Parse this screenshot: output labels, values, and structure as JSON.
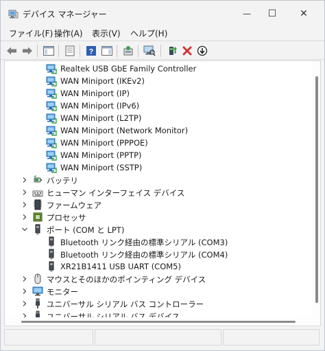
{
  "window": {
    "title": "デバイス マネージャー",
    "minimize_glyph": "—",
    "maximize_glyph": "☐",
    "close_glyph": "✕"
  },
  "menu": {
    "items": [
      "ファイル(F)",
      "操作(A)",
      "表示(V)",
      "ヘルプ(H)"
    ]
  },
  "toolbar": {
    "icons": [
      "back-arrow-icon",
      "forward-arrow-icon",
      "show-hide-console-tree-icon",
      "properties-icon",
      "help-icon",
      "action-pane-icon",
      "update-driver-icon",
      "scan-hardware-icon",
      "enable-device-icon",
      "uninstall-device-icon",
      "disable-device-icon"
    ]
  },
  "tree": {
    "rows": [
      {
        "label": "Realtek USB GbE Family Controller",
        "icon": "network-adapter-icon",
        "indent": 2
      },
      {
        "label": "WAN Miniport (IKEv2)",
        "icon": "network-adapter-icon",
        "indent": 2
      },
      {
        "label": "WAN Miniport (IP)",
        "icon": "network-adapter-icon",
        "indent": 2
      },
      {
        "label": "WAN Miniport (IPv6)",
        "icon": "network-adapter-icon",
        "indent": 2
      },
      {
        "label": "WAN Miniport (L2TP)",
        "icon": "network-adapter-icon",
        "indent": 2
      },
      {
        "label": "WAN Miniport (Network Monitor)",
        "icon": "network-adapter-icon",
        "indent": 2
      },
      {
        "label": "WAN Miniport (PPPOE)",
        "icon": "network-adapter-icon",
        "indent": 2
      },
      {
        "label": "WAN Miniport (PPTP)",
        "icon": "network-adapter-icon",
        "indent": 2
      },
      {
        "label": "WAN Miniport (SSTP)",
        "icon": "network-adapter-icon",
        "indent": 2
      },
      {
        "label": "バッテリ",
        "icon": "battery-icon",
        "indent": 1,
        "expander": "collapsed"
      },
      {
        "label": "ヒューマン インターフェイス デバイス",
        "icon": "hid-icon",
        "indent": 1,
        "expander": "collapsed"
      },
      {
        "label": "ファームウェア",
        "icon": "firmware-icon",
        "indent": 1,
        "expander": "collapsed"
      },
      {
        "label": "プロセッサ",
        "icon": "processor-icon",
        "indent": 1,
        "expander": "collapsed"
      },
      {
        "label": "ポート (COM と LPT)",
        "icon": "port-icon",
        "indent": 1,
        "expander": "expanded"
      },
      {
        "label": "Bluetooth リンク経由の標準シリアル (COM3)",
        "icon": "port-icon",
        "indent": 2
      },
      {
        "label": "Bluetooth リンク経由の標準シリアル (COM4)",
        "icon": "port-icon",
        "indent": 2
      },
      {
        "label": "XR21B1411 USB UART (COM5)",
        "icon": "port-icon",
        "indent": 2
      },
      {
        "label": "マウスとそのほかのポインティング デバイス",
        "icon": "mouse-icon",
        "indent": 1,
        "expander": "collapsed"
      },
      {
        "label": "モニター",
        "icon": "monitor-icon",
        "indent": 1,
        "expander": "collapsed"
      },
      {
        "label": "ユニバーサル シリアル バス コントローラー",
        "icon": "usb-icon",
        "indent": 1,
        "expander": "collapsed"
      },
      {
        "label": "ユニバーサル シリアル バス デバイス",
        "icon": "usb-icon",
        "indent": 1,
        "expander": "collapsed"
      }
    ]
  },
  "colors": {
    "accent": "#2b88d8",
    "remove_red": "#d13438",
    "enable_green": "#2e9e3e"
  }
}
